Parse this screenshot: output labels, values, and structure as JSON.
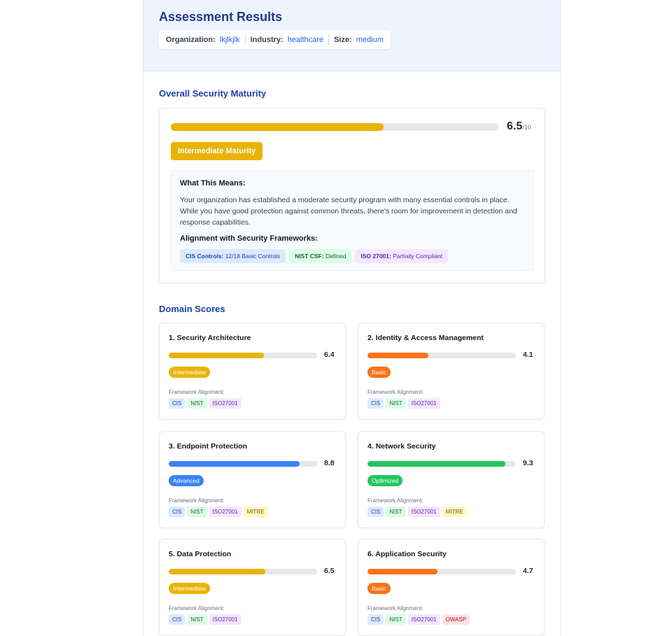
{
  "header": {
    "title": "Assessment Results",
    "org_label": "Organization:",
    "org_value": "lkjlkjlk",
    "industry_label": "Industry:",
    "industry_value": "healthcare",
    "size_label": "Size:",
    "size_value": "medium"
  },
  "overall": {
    "section_title": "Overall Security Maturity",
    "score": "6.5",
    "score_max": "/10",
    "score_fraction": 0.65,
    "maturity_label": "Intermediate Maturity",
    "maturity_color": "#eab308",
    "what_title": "What This Means:",
    "what_text": "Your organization has established a moderate security program with many essential controls in place. While you have good protection against common threats, there's room for improvement in detection and response capabilities.",
    "alignment_title": "Alignment with Security Frameworks:",
    "frameworks": [
      {
        "name": "CIS Controls:",
        "value": "12/18 Basic Controls",
        "bg": "#dbeafe",
        "fg": "#1e40af"
      },
      {
        "name": "NIST CSF:",
        "value": "Defined",
        "bg": "#dcfce7",
        "fg": "#166534"
      },
      {
        "name": "ISO 27001:",
        "value": "Partially Compliant",
        "bg": "#f3e8ff",
        "fg": "#6b21a8"
      }
    ]
  },
  "domains_section_title": "Domain Scores",
  "framework_alignment_label": "Framework Alignment:",
  "domains": [
    {
      "name": "1. Security Architecture",
      "score": "6.4",
      "fraction": 0.64,
      "level": "Intermediate",
      "color": "#eab308",
      "tags": [
        "CIS",
        "NIST",
        "ISO27001"
      ]
    },
    {
      "name": "2. Identity & Access Management",
      "score": "4.1",
      "fraction": 0.41,
      "level": "Basic",
      "color": "#f97316",
      "tags": [
        "CIS",
        "NIST",
        "ISO27001"
      ]
    },
    {
      "name": "3. Endpoint Protection",
      "score": "8.8",
      "fraction": 0.88,
      "level": "Advanced",
      "color": "#3b82f6",
      "tags": [
        "CIS",
        "NIST",
        "ISO27001",
        "MITRE"
      ]
    },
    {
      "name": "4. Network Security",
      "score": "9.3",
      "fraction": 0.93,
      "level": "Optimized",
      "color": "#22c55e",
      "tags": [
        "CIS",
        "NIST",
        "ISO27001",
        "MITRE"
      ]
    },
    {
      "name": "5. Data Protection",
      "score": "6.5",
      "fraction": 0.65,
      "level": "Intermediate",
      "color": "#eab308",
      "tags": [
        "CIS",
        "NIST",
        "ISO27001"
      ]
    },
    {
      "name": "6. Application Security",
      "score": "4.7",
      "fraction": 0.47,
      "level": "Basic",
      "color": "#f97316",
      "tags": [
        "CIS",
        "NIST",
        "ISO27001",
        "OWASP"
      ]
    }
  ]
}
